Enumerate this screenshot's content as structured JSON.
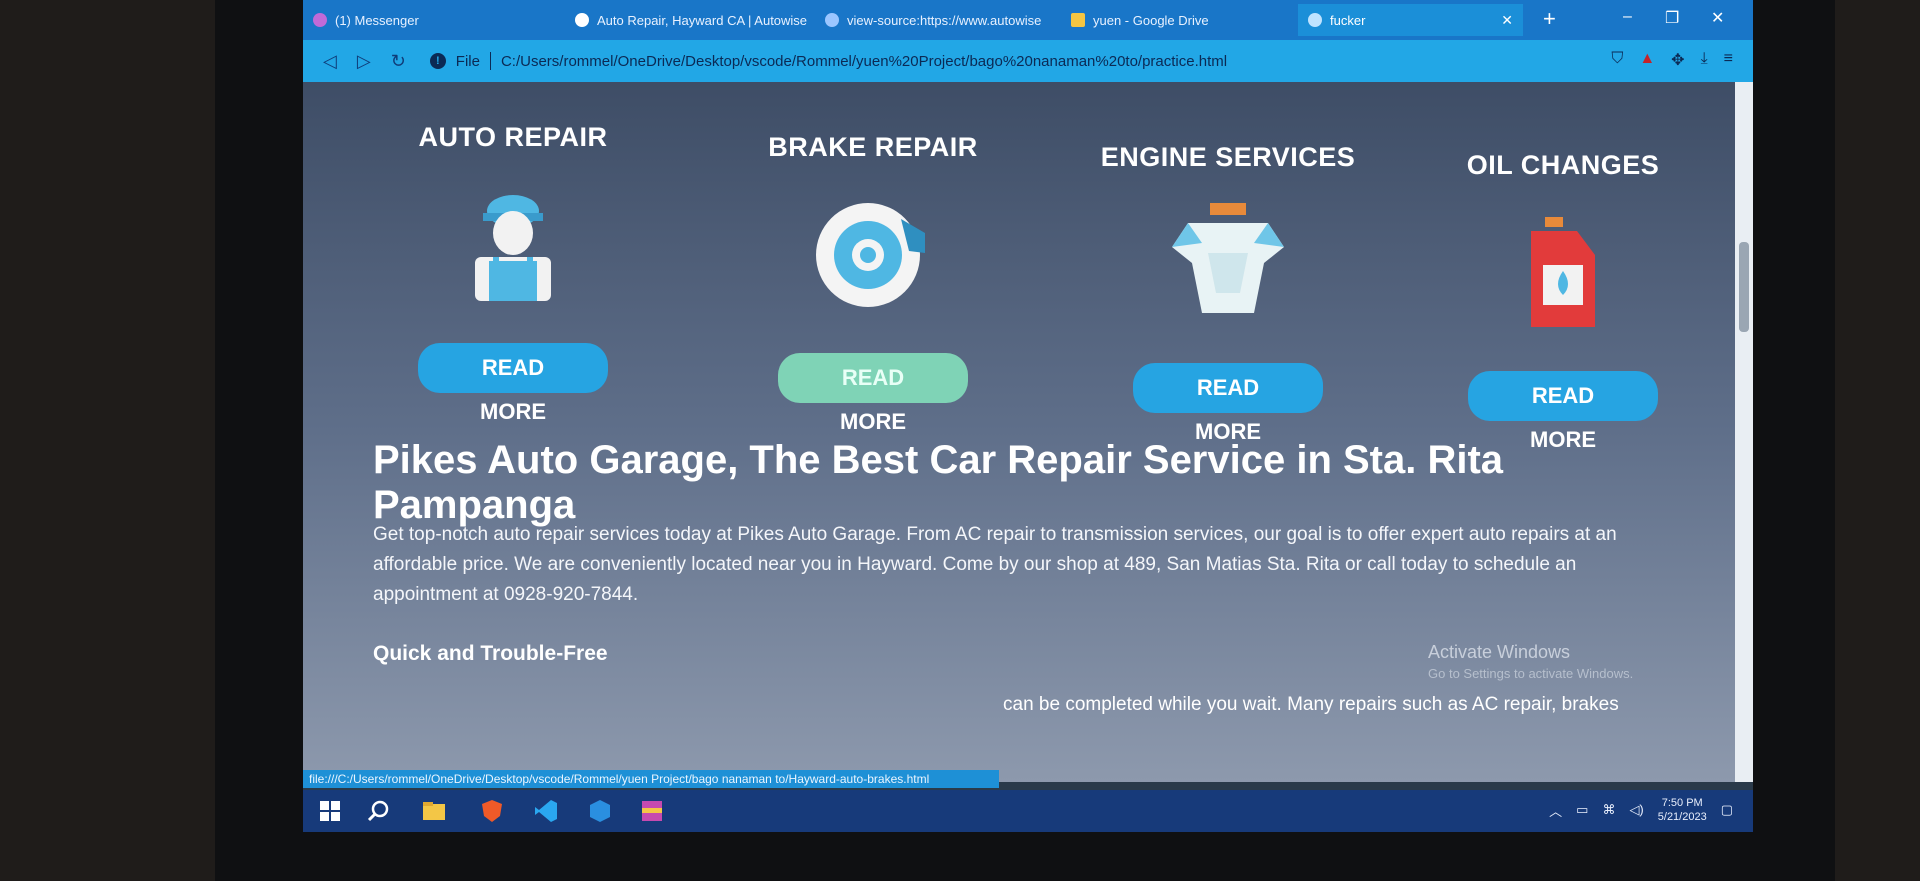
{
  "browser": {
    "tabs": [
      {
        "title": "(1) Messenger"
      },
      {
        "title": "Auto Repair, Hayward CA | Autowise"
      },
      {
        "title": "view-source:https://www.autowise"
      },
      {
        "title": "yuen - Google Drive"
      },
      {
        "title": "fucker"
      }
    ],
    "new_tab": "+",
    "window_controls": {
      "minimize": "–",
      "restore": "❐",
      "close": "✕"
    },
    "address": {
      "protocol_label": "File",
      "url": "C:/Users/rommel/OneDrive/Desktop/vscode/Rommel/yuen%20Project/bago%20nanaman%20to/practice.html"
    },
    "status_url": "file:///C:/Users/rommel/OneDrive/Desktop/vscode/Rommel/yuen Project/bago nanaman to/Hayward-auto-brakes.html"
  },
  "services": [
    {
      "title": "AUTO REPAIR",
      "read": "READ",
      "more": "MORE",
      "icon": "mechanic-icon"
    },
    {
      "title": "BRAKE REPAIR",
      "read": "READ",
      "more": "MORE",
      "icon": "brake-disc-icon"
    },
    {
      "title": "ENGINE SERVICES",
      "read": "READ",
      "more": "MORE",
      "icon": "engine-icon"
    },
    {
      "title": "OIL CHANGES",
      "read": "READ",
      "more": "MORE",
      "icon": "oil-can-icon"
    }
  ],
  "main": {
    "headline": "Pikes Auto Garage, The Best Car Repair Service in Sta. Rita Pampanga",
    "paragraph": "Get top-notch auto repair services today at Pikes Auto Garage. From AC repair to transmission services, our goal is to offer expert auto repairs at an affordable price. We are conveniently located near you in Hayward. Come by our shop at 489, San Matias Sta. Rita or call today to schedule an appointment at 0928-920-7844.",
    "subheading": "Quick and Trouble-Free",
    "partial_text": "can be completed while you wait. Many repairs such as AC repair, brakes"
  },
  "watermark": {
    "line1": "Activate Windows",
    "line2": "Go to Settings to activate Windows."
  },
  "taskbar": {
    "time": "7:50 PM",
    "date": "5/21/2023"
  }
}
